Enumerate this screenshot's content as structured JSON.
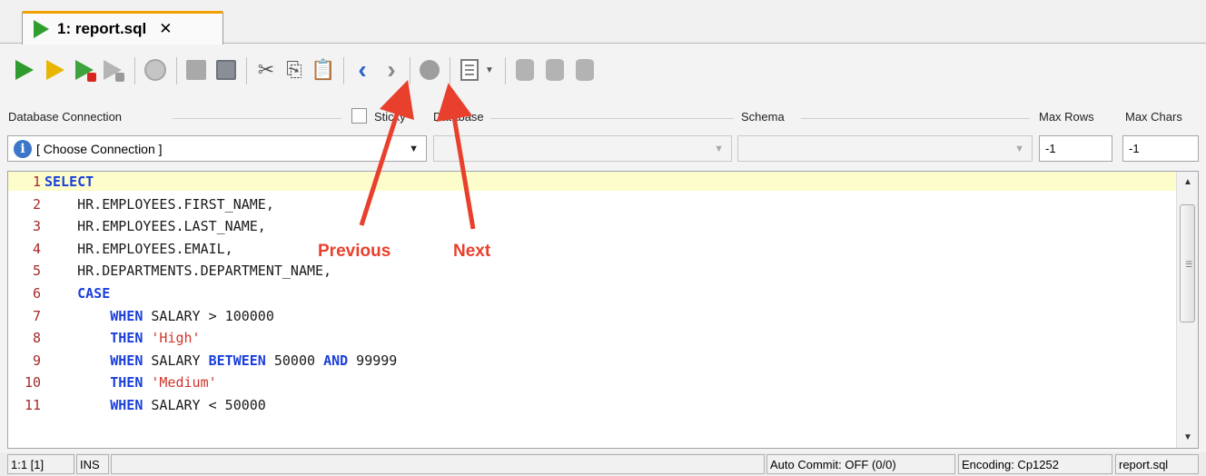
{
  "tab": {
    "title": "1: report.sql",
    "close": "✕"
  },
  "labels": {
    "database_connection": "Database Connection",
    "sticky": "Sticky",
    "database": "Database",
    "schema": "Schema",
    "max_rows": "Max Rows",
    "max_chars": "Max Chars"
  },
  "connection": {
    "value": "[ Choose Connection ]",
    "info": "i"
  },
  "max_rows_value": "-1",
  "max_chars_value": "-1",
  "editor": {
    "lines": [
      {
        "n": "1",
        "code": "SELECT"
      },
      {
        "n": "2",
        "code": "    HR.EMPLOYEES.FIRST_NAME,"
      },
      {
        "n": "3",
        "code": "    HR.EMPLOYEES.LAST_NAME,"
      },
      {
        "n": "4",
        "code": "    HR.EMPLOYEES.EMAIL,"
      },
      {
        "n": "5",
        "code": "    HR.DEPARTMENTS.DEPARTMENT_NAME,"
      },
      {
        "n": "6",
        "code": "    CASE"
      },
      {
        "n": "7",
        "code": "        WHEN SALARY > 100000"
      },
      {
        "n": "8",
        "code": "        THEN 'High'"
      },
      {
        "n": "9",
        "code": "        WHEN SALARY BETWEEN 50000 AND 99999"
      },
      {
        "n": "10",
        "code": "        THEN 'Medium'"
      },
      {
        "n": "11",
        "code": "        WHEN SALARY < 50000"
      }
    ]
  },
  "annotations": {
    "previous": "Previous",
    "next": "Next"
  },
  "status": {
    "position": "1:1 [1]",
    "mode": "INS",
    "auto_commit": "Auto Commit: OFF (0/0)",
    "encoding": "Encoding: Cp1252",
    "file": "report.sql"
  },
  "colors": {
    "keyword": "#1a3fd9",
    "string": "#d0352b",
    "line_number": "#a52a2a",
    "annotation": "#e8402d",
    "current_line": "#fdfccb"
  }
}
